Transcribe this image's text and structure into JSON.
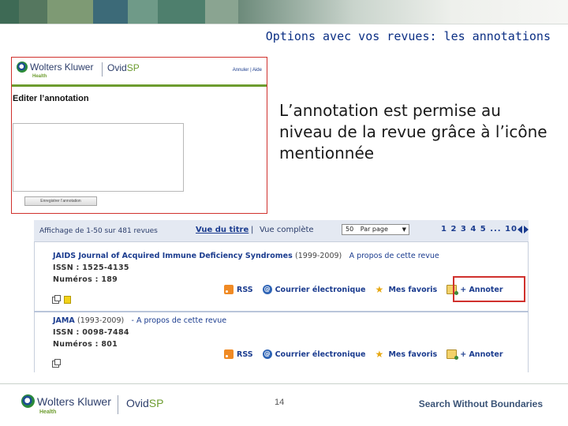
{
  "slide": {
    "title": "Options avec vos revues: les annotations",
    "caption": "L’annotation est permise au niveau de la revue grâce à l’icône mentionnée",
    "page_number": "14",
    "slogan": "Search Without Boundaries"
  },
  "branding": {
    "company": "Wolters Kluwer",
    "division": "Health",
    "product_prefix": "Ovid",
    "product_suffix": "SP"
  },
  "colors": {
    "accent_red": "#d0312d",
    "link_blue": "#1b3c8f",
    "title_blue": "#0b2f84",
    "brand_green": "#6d9c2f"
  },
  "annotation_editor": {
    "header_links": "Annuler | Aide",
    "heading": "Editer l’annotation",
    "textarea_value": "",
    "save_button": "Enregistrer l’annotation"
  },
  "journal_list": {
    "display_count": "Affichage de 1-50 sur 481 revues",
    "view_title": "Vue du titre",
    "separator": "|",
    "view_full": "Vue complète",
    "per_page_value": "50",
    "per_page_label": "Par page",
    "pagination": "1 2 3 4 5 ... 10",
    "journals": [
      {
        "title": "JAIDS Journal of Acquired Immune Deficiency Syndromes",
        "years": "(1999-2009)",
        "about": "A propos de cette revue",
        "issn": "ISSN : 1525-4135",
        "numbers": "Numéros : 189"
      },
      {
        "title": "JAMA",
        "years": "(1993-2009)",
        "about": "- A propos de cette revue",
        "issn": "ISSN : 0098-7484",
        "numbers": "Numéros : 801"
      }
    ],
    "actions": {
      "rss": "RSS",
      "email": "Courrier électronique",
      "favorites": "Mes favoris",
      "annotate": "+ Annoter"
    }
  }
}
